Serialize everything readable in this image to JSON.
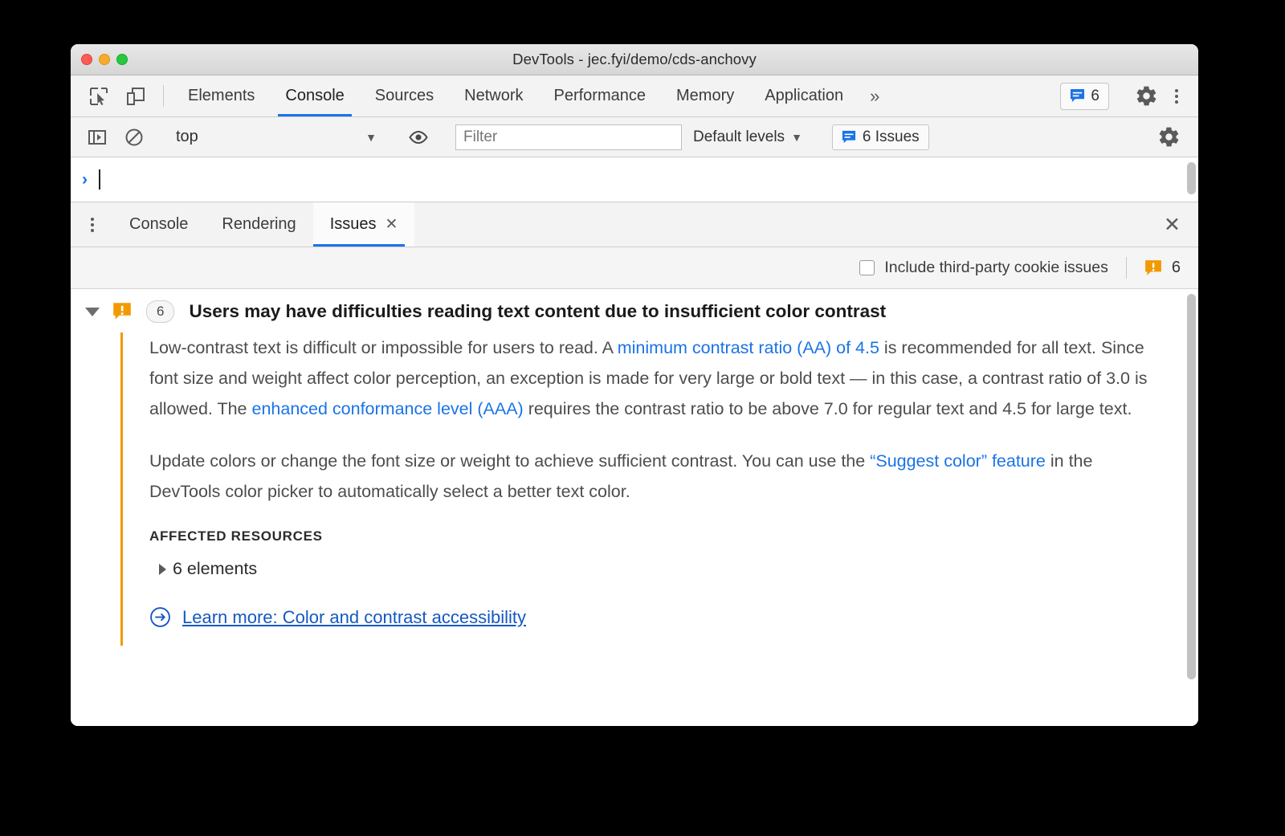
{
  "window": {
    "title": "DevTools - jec.fyi/demo/cds-anchovy",
    "traffic_lights": [
      "close",
      "minimize",
      "maximize"
    ]
  },
  "main_toolbar": {
    "inspect_icon": "inspect-element-icon",
    "device_icon": "device-toolbar-icon",
    "tabs": [
      {
        "label": "Elements",
        "active": false
      },
      {
        "label": "Console",
        "active": true
      },
      {
        "label": "Sources",
        "active": false
      },
      {
        "label": "Network",
        "active": false
      },
      {
        "label": "Performance",
        "active": false
      },
      {
        "label": "Memory",
        "active": false
      },
      {
        "label": "Application",
        "active": false
      }
    ],
    "more_tabs_label": "»",
    "issues_chip": {
      "icon": "issue-bubble-icon",
      "count": "6"
    },
    "settings_icon": "gear-icon",
    "menu_icon": "kebab-menu-icon"
  },
  "console_toolbar": {
    "sidebar_toggle_icon": "console-sidebar-icon",
    "clear_icon": "clear-console-icon",
    "context": {
      "value": "top",
      "caret": "▼"
    },
    "eye_icon": "live-expression-eye-icon",
    "filter": {
      "value": "",
      "placeholder": "Filter"
    },
    "levels": {
      "label": "Default levels",
      "caret": "▼"
    },
    "issues_button": {
      "icon": "issue-bubble-icon",
      "label": "6 Issues"
    },
    "settings_icon": "gear-icon"
  },
  "console_prompt": {
    "arrow": "›",
    "value": ""
  },
  "drawer": {
    "menu_icon": "kebab-menu-icon",
    "tabs": [
      {
        "label": "Console",
        "active": false,
        "closable": false
      },
      {
        "label": "Rendering",
        "active": false,
        "closable": false
      },
      {
        "label": "Issues",
        "active": true,
        "closable": true,
        "close_glyph": "✕"
      }
    ],
    "close_drawer_glyph": "✕"
  },
  "issues_filter": {
    "checkbox": {
      "label": "Include third-party cookie issues",
      "checked": false
    },
    "warning_icon": "warning-bubble-icon",
    "warning_count": "6"
  },
  "issue": {
    "expanded": true,
    "expand_glyph": "▼",
    "icon": "warning-bubble-icon",
    "count": "6",
    "title": "Users may have difficulties reading text content due to insufficient color contrast",
    "paragraph1": {
      "part1": "Low-contrast text is difficult or impossible for users to read. A ",
      "link1": "minimum contrast ratio (AA) of 4.5",
      "part2": " is recommended for all text. Since font size and weight affect color perception, an exception is made for very large or bold text — in this case, a contrast ratio of 3.0 is allowed. The ",
      "link2": "enhanced conformance level (AAA)",
      "part3": " requires the contrast ratio to be above 7.0 for regular text and 4.5 for large text."
    },
    "paragraph2": {
      "part1": "Update colors or change the font size or weight to achieve sufficient contrast. You can use the ",
      "link1": "“Suggest color” feature",
      "part2": " in the DevTools color picker to automatically select a better text color."
    },
    "affected_resources_label": "AFFECTED RESOURCES",
    "affected_resources_item": "6 elements",
    "affected_resources_expanded": false,
    "learn_more": {
      "icon": "arrow-circle-right-icon",
      "label": "Learn more: Color and contrast accessibility"
    }
  },
  "colors": {
    "accent_blue": "#1a73e8",
    "warning_orange": "#f29900",
    "link_blue": "#1558c0",
    "body_text": "#4d4d4d",
    "toolbar_bg": "#f3f3f3"
  }
}
